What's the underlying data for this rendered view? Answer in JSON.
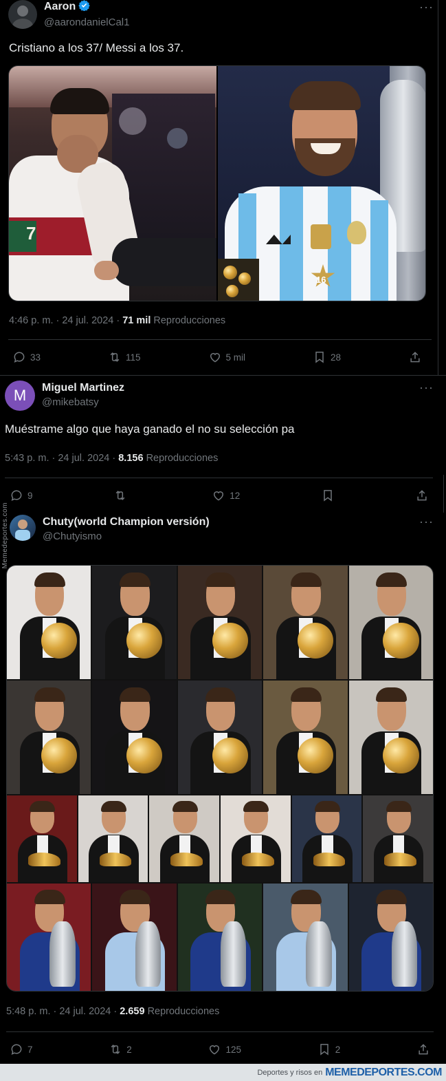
{
  "tweet1": {
    "display_name": "Aaron",
    "handle": "@aarondanielCal1",
    "text": "Cristiano a los 37/ Messi a los 37.",
    "time": "4:46 p. m. · 24 jul. 2024 · ",
    "views_count": "71 mil",
    "views_label": "Reproducciones",
    "replies": "33",
    "retweets": "115",
    "likes": "5 mil",
    "bookmarks": "28",
    "jersey_left": "7",
    "jersey_right": "16"
  },
  "tweet2": {
    "avatar_letter": "M",
    "avatar_color": "#7b4fb8",
    "display_name": "Miguel Martinez",
    "handle": "@mikebatsy",
    "text": "Muéstrame algo que haya ganado el no su selección pa",
    "time": "5:43 p. m. · 24 jul. 2024 · ",
    "views_count": "8.156",
    "views_label": "Reproducciones",
    "replies": "9",
    "retweets": "",
    "likes": "12"
  },
  "tweet3": {
    "display_name": "Chuty(world Champion versión)",
    "handle": "@Chutyismo",
    "time": "5:48 p. m. · 24 jul. 2024 · ",
    "views_count": "2.659",
    "views_label": "Reproducciones",
    "replies": "7",
    "retweets": "2",
    "likes": "125",
    "bookmarks": "2"
  },
  "colors": {
    "background": "#000000",
    "text_primary": "#e7e9ea",
    "text_secondary": "#71767b",
    "divider": "#2f3336",
    "verified": "#1d9bf0"
  },
  "watermark": {
    "side": "Memedeportes.com",
    "footer_small": "Deportes y risos en",
    "footer_brand": "MEMEDEPORTES.COM"
  }
}
